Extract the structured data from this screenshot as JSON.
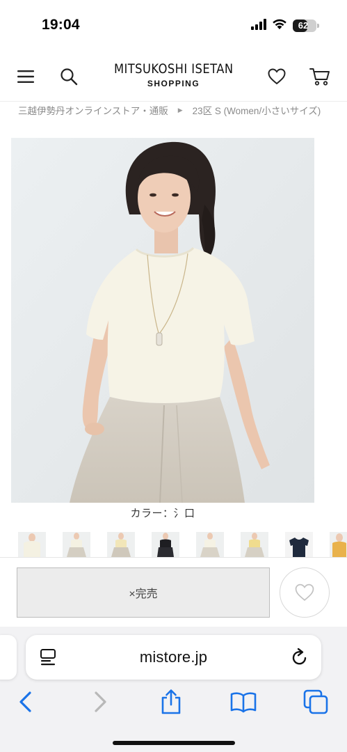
{
  "status_bar": {
    "time": "19:04",
    "battery": 62,
    "battery_label": "62",
    "icons": [
      "signal-icon",
      "wifi-icon",
      "battery-icon"
    ]
  },
  "header": {
    "logo_main": "MITSUKOSHI ISETAN",
    "logo_sub": "SHOPPING",
    "icons": [
      "menu-icon",
      "search-icon",
      "heart-icon",
      "cart-icon"
    ]
  },
  "breadcrumb": {
    "items": [
      "三越伊勢丹オンラインストア・通販",
      "23区 S (Women/小さいサイズ)"
    ]
  },
  "product": {
    "color_label": "カラー：氵口"
  },
  "buy_bar": {
    "soldout_label": "×完売",
    "icons": [
      "heart-icon"
    ]
  },
  "safari": {
    "url": "mistore.jp",
    "icons": [
      "tab-overview-icon",
      "reload-icon",
      "back-icon",
      "forward-icon",
      "share-icon",
      "bookmarks-icon",
      "tabs-icon"
    ]
  },
  "colors": {
    "accent_blue": "#1a73e8",
    "disabled_gray": "#b8b8b8",
    "soldout_bg": "#ececec"
  }
}
